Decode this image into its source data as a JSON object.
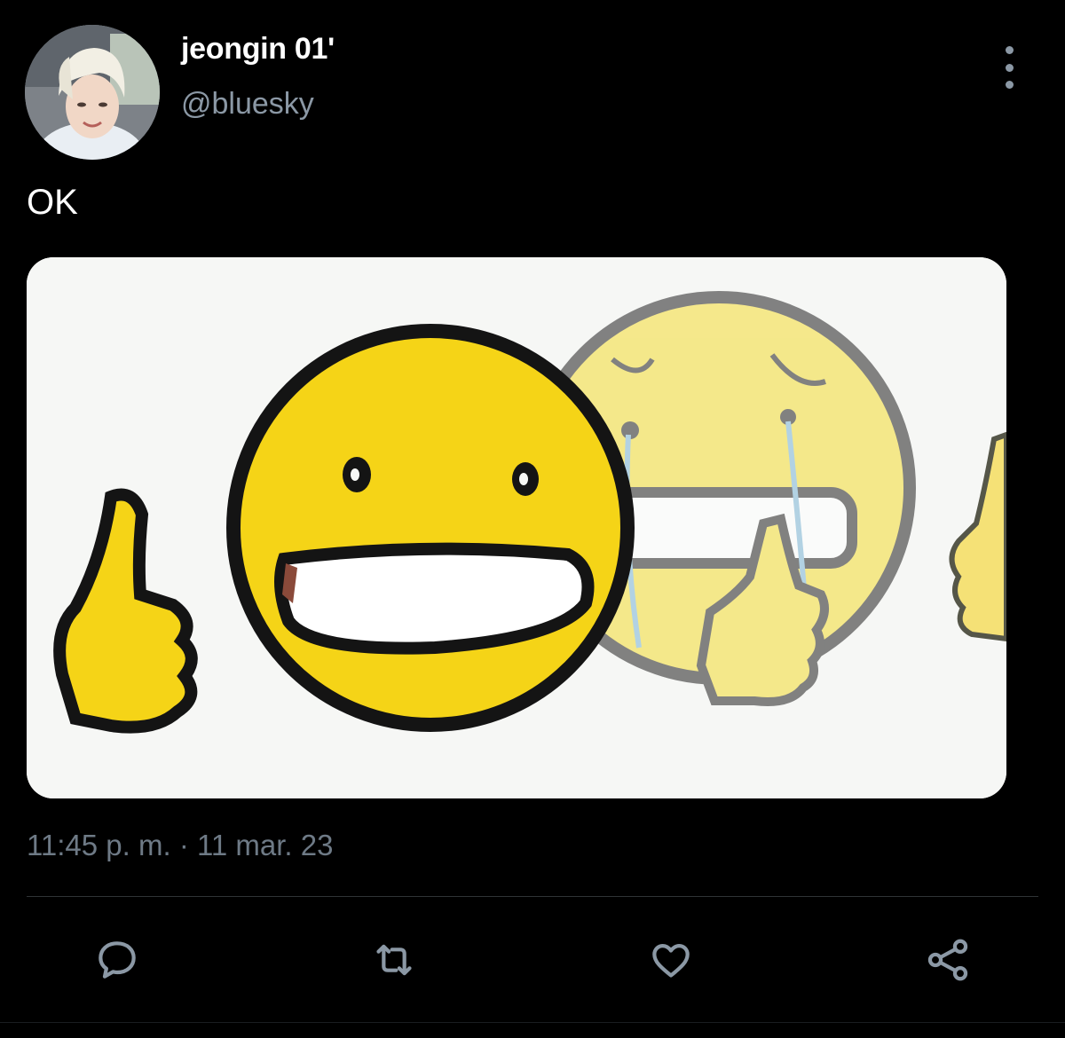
{
  "tweet": {
    "author_name": "jeongin 01'",
    "author_handle": "@bluesky",
    "text": "OK",
    "timestamp": "11:45 p. m. · 11 mar. 23"
  },
  "icons": {
    "more": "more-vertical-icon",
    "reply": "reply-icon",
    "retweet": "retweet-icon",
    "like": "heart-icon",
    "share": "share-icon"
  },
  "colors": {
    "background": "#000000",
    "secondary_text": "#8b98a5",
    "timestamp_text": "#6e7a86",
    "icon": "#8b98a5",
    "emoji_yellow": "#f7d92a"
  }
}
